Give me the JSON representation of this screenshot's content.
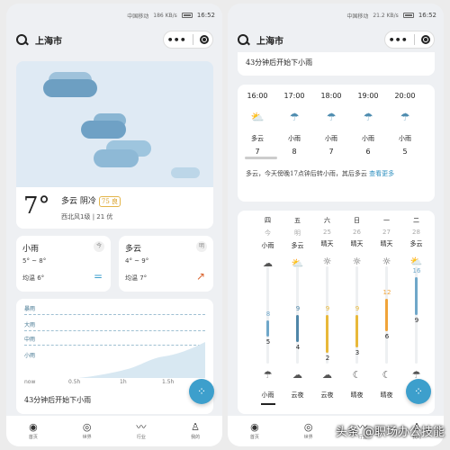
{
  "status": {
    "carrier": "中国移动",
    "signal": "HD",
    "speed1": "186 KB/s",
    "speed2": "21.2 KB/s",
    "time": "16:52"
  },
  "app": {
    "city": "上海市",
    "more": "•••"
  },
  "now": {
    "temp": "7°",
    "condition": "多云 阴冷",
    "aqi": "75 良",
    "wind": "西北风1级",
    "humidity": "21 优"
  },
  "today": {
    "title": "小雨",
    "tag": "今",
    "range": "5° ~ 8°",
    "avg": "均温 6°",
    "trend": "="
  },
  "tomorrow": {
    "title": "多云",
    "tag": "明",
    "range": "4° ~ 9°",
    "avg": "均温 7°",
    "trend": "↗"
  },
  "rain": {
    "levels": [
      "暴雨",
      "大雨",
      "中雨",
      "小雨"
    ],
    "x_ticks": [
      "now",
      "0.5h",
      "1h",
      "1.5h"
    ],
    "text": "43分钟后开始下小雨"
  },
  "summary": "43分钟后开始下小雨",
  "hourly": [
    {
      "time": "16:00",
      "weather": "多云",
      "temp": "7",
      "icon": "cloud-sun-icon"
    },
    {
      "time": "17:00",
      "weather": "小雨",
      "temp": "8",
      "icon": "rain-icon"
    },
    {
      "time": "18:00",
      "weather": "小雨",
      "temp": "7",
      "icon": "rain-icon"
    },
    {
      "time": "19:00",
      "weather": "小雨",
      "temp": "6",
      "icon": "rain-icon"
    },
    {
      "time": "20:00",
      "weather": "小雨",
      "temp": "5",
      "icon": "rain-icon"
    }
  ],
  "hourly_desc": "多云，今天傍晚17点钟后转小雨，其后多云",
  "hourly_more": "查看更多",
  "daily": [
    {
      "week": "四",
      "date": "今",
      "day_weather": "小雨",
      "high": "8",
      "low": "5",
      "night_weather": "小雨"
    },
    {
      "week": "五",
      "date": "明",
      "day_weather": "多云",
      "high": "9",
      "low": "4",
      "night_weather": "云夜"
    },
    {
      "week": "六",
      "date": "25",
      "day_weather": "晴天",
      "high": "9",
      "low": "2",
      "night_weather": "云夜"
    },
    {
      "week": "日",
      "date": "26",
      "day_weather": "晴天",
      "high": "9",
      "low": "3",
      "night_weather": "晴夜"
    },
    {
      "week": "一",
      "date": "27",
      "day_weather": "晴天",
      "high": "12",
      "low": "6",
      "night_weather": "晴夜"
    },
    {
      "week": "二",
      "date": "28",
      "day_weather": "多云",
      "high": "16",
      "low": "9",
      "night_weather": "小雨"
    }
  ],
  "nav": [
    "首页",
    "世界",
    "行业",
    "我的"
  ],
  "fab": "⁘",
  "watermark": "头条 @职场办公技能"
}
